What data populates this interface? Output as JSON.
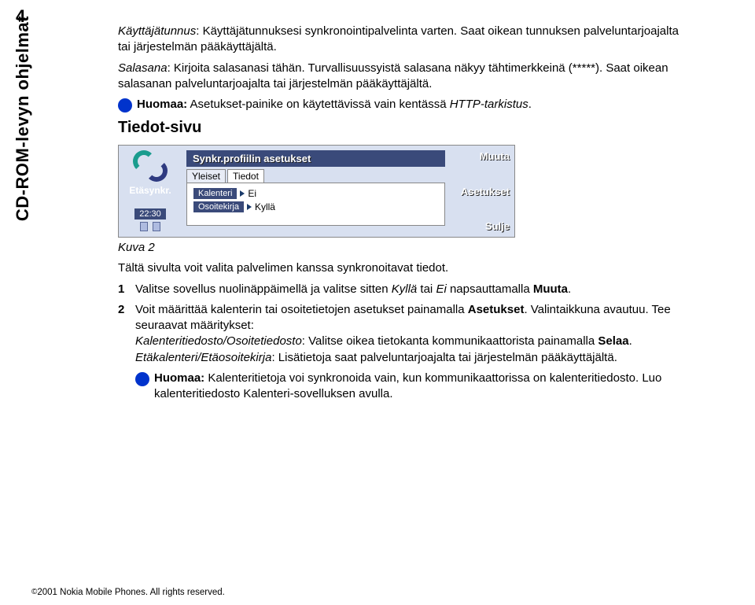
{
  "page_number": "4",
  "side_label": "CD-ROM-levyn ohjelmat",
  "p1": {
    "term1": "Käyttäjätunnus",
    "rest1": ": Käyttäjätunnuksesi synkronointipalvelinta varten. Saat oikean tunnuksen palveluntarjoajalta tai järjestelmän pääkäyttäjältä.",
    "term2": "Salasana",
    "rest2": ": Kirjoita salasanasi tähän. Turvallisuussyistä salasana näkyy tähtimerkkeinä (*****). Saat oikean salasanan palveluntarjoajalta tai järjestelmän pääkäyttäjältä."
  },
  "note1": {
    "label": "Huomaa:",
    "text_a": " Asetukset-painike on käytettävissä vain kentässä ",
    "italic": "HTTP-tarkistus",
    "text_b": "."
  },
  "section_heading": "Tiedot-sivu",
  "device": {
    "left_label": "Etäsynkr.",
    "time": "22:30",
    "title": "Synkr.profiilin asetukset",
    "tabs": {
      "a": "Yleiset",
      "b": "Tiedot"
    },
    "row1": {
      "label": "Kalenteri",
      "value": "Ei"
    },
    "row2": {
      "label": "Osoitekirja",
      "value": "Kyllä"
    },
    "soft": {
      "top": "Muuta",
      "mid": "Asetukset",
      "bot": "Sulje"
    }
  },
  "fig_caption": "Kuva 2",
  "p_after": "Tältä sivulta voit valita palvelimen kanssa synkronoitavat tiedot.",
  "li1": {
    "num": "1",
    "a": "Valitse sovellus nuolinäppäimellä ja valitse sitten ",
    "i1": "Kyllä",
    "b": " tai ",
    "i2": "Ei",
    "c": " napsauttamalla ",
    "bold": "Muuta",
    "d": "."
  },
  "li2": {
    "num": "2",
    "a": "Voit määrittää kalenterin tai osoitetietojen asetukset painamalla ",
    "bold1": "Asetukset",
    "b": ". Valintaikkuna avautuu. Tee seuraavat määritykset:",
    "line2_i": "Kalenteritiedosto/Osoitetiedosto",
    "line2_a": ": Valitse oikea tietokanta kommunikaattorista painamalla ",
    "line2_bold": "Selaa",
    "line2_b": ".",
    "line3_i": "Etäkalenteri/Etäosoitekirja",
    "line3_a": ": Lisätietoja saat palveluntarjoajalta tai järjestelmän pääkäyttäjältä."
  },
  "note2": {
    "label": "Huomaa:",
    "text": " Kalenteritietoja voi synkronoida vain, kun kommunikaattorissa on kalenteritiedosto. Luo kalenteritiedosto Kalenteri-sovelluksen avulla."
  },
  "footer": {
    "copy": "©",
    "text": "2001 Nokia Mobile Phones. All rights reserved."
  }
}
